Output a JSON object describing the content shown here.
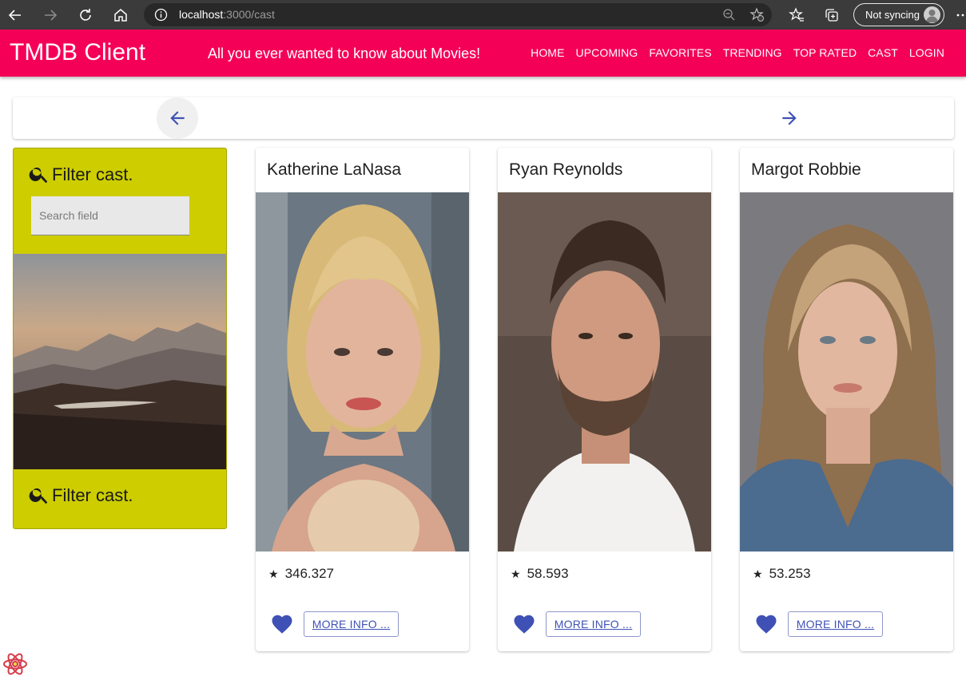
{
  "browser": {
    "url_host": "localhost",
    "url_path": ":3000/cast",
    "sync_label": "Not syncing"
  },
  "header": {
    "brand": "TMDB Client",
    "tagline": "All you ever wanted to know about Movies!",
    "menu": [
      "HOME",
      "UPCOMING",
      "FAVORITES",
      "TRENDING",
      "TOP RATED",
      "CAST",
      "LOGIN"
    ]
  },
  "filter": {
    "title_top": "Filter cast.",
    "search_placeholder": "Search field",
    "title_bottom": "Filter cast."
  },
  "cast": [
    {
      "name": "Katherine LaNasa",
      "popularity": "346.327",
      "more_label": "MORE INFO ..."
    },
    {
      "name": "Ryan Reynolds",
      "popularity": "58.593",
      "more_label": "MORE INFO ..."
    },
    {
      "name": "Margot Robbie",
      "popularity": "53.253",
      "more_label": "MORE INFO ..."
    }
  ],
  "colors": {
    "header": "#f50057",
    "filter_card": "#cdcd00",
    "primary": "#3f51b5"
  },
  "icons": {
    "prev": "arrow-left-icon",
    "next": "arrow-right-icon",
    "favorite": "heart-icon",
    "search": "search-icon"
  }
}
